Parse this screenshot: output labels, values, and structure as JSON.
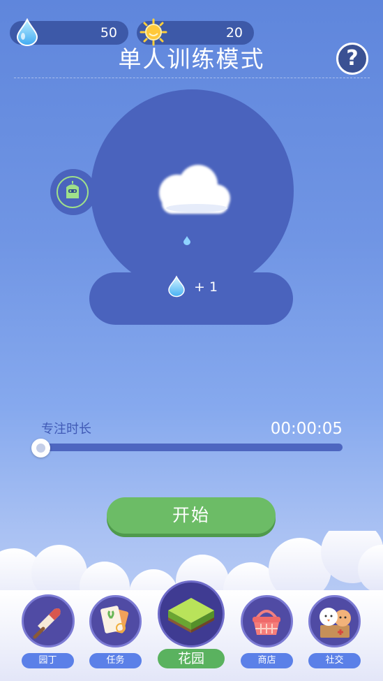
{
  "resources": {
    "water_count": "50",
    "sun_count": "20"
  },
  "header": {
    "title": "单人训练模式",
    "help_label": "?"
  },
  "plant_card": {
    "reward_text": "+ 1"
  },
  "focus": {
    "label": "专注时长",
    "time": "00:00:05",
    "progress_fraction": 0.0
  },
  "start_button": {
    "label": "开始"
  },
  "nav": {
    "items": [
      {
        "label": "园丁",
        "icon": "shovel-icon"
      },
      {
        "label": "任务",
        "icon": "task-cards-icon"
      },
      {
        "label": "花园",
        "icon": "grass-tile-icon"
      },
      {
        "label": "商店",
        "icon": "basket-icon"
      },
      {
        "label": "社交",
        "icon": "friends-icon"
      }
    ]
  },
  "colors": {
    "panel": "#4a63bd",
    "accent_green": "#6cbc66",
    "nav_label": "#5b80e8"
  }
}
